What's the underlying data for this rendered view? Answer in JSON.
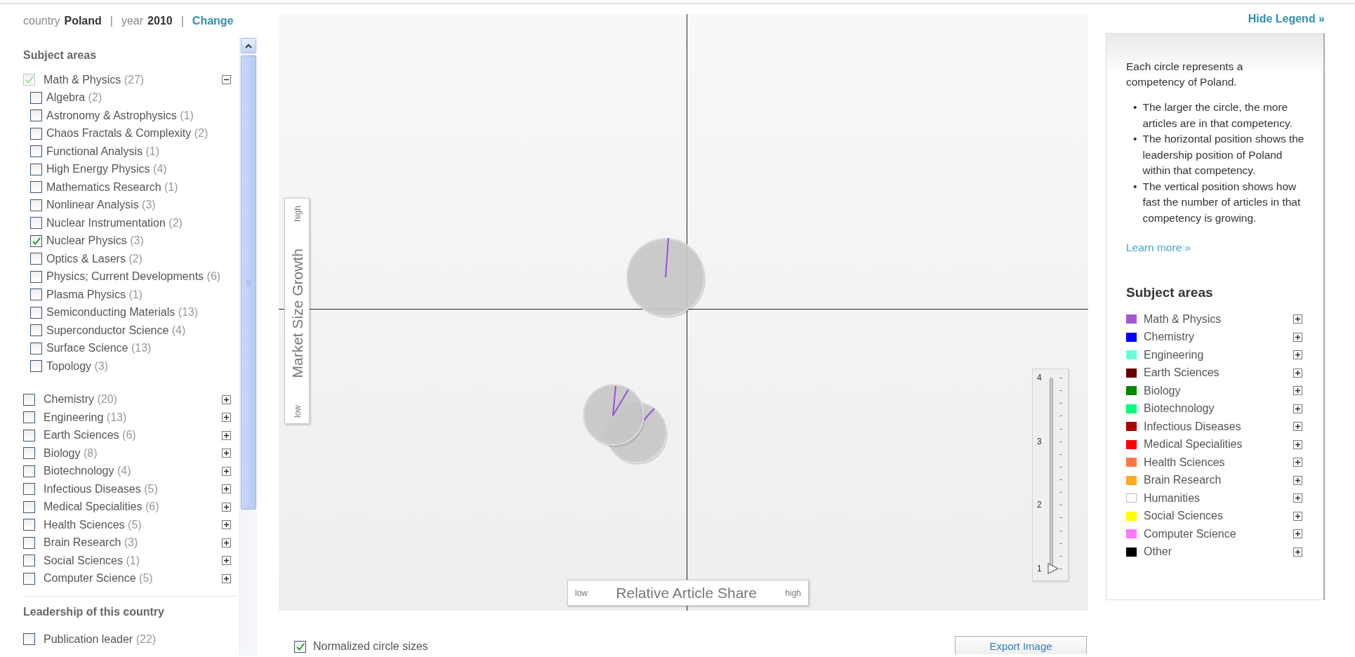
{
  "header": {
    "country_label": "country",
    "country": "Poland",
    "year_label": "year",
    "year": "2010",
    "separators": [
      "|",
      "|"
    ],
    "change_link": "Change"
  },
  "filters": {
    "title": "Subject areas",
    "groups": [
      {
        "label": "Math & Physics",
        "count": "(27)",
        "checked": true,
        "expanded": true,
        "children": [
          {
            "label": "Algebra",
            "count": "(2)",
            "checked": false
          },
          {
            "label": "Astronomy & Astrophysics",
            "count": "(1)",
            "checked": false
          },
          {
            "label": "Chaos Fractals & Complexity",
            "count": "(2)",
            "checked": false
          },
          {
            "label": "Functional Analysis",
            "count": "(1)",
            "checked": false
          },
          {
            "label": "High Energy Physics",
            "count": "(4)",
            "checked": false
          },
          {
            "label": "Mathematics Research",
            "count": "(1)",
            "checked": false
          },
          {
            "label": "Nonlinear Analysis",
            "count": "(3)",
            "checked": false
          },
          {
            "label": "Nuclear Instrumentation",
            "count": "(2)",
            "checked": false
          },
          {
            "label": "Nuclear Physics",
            "count": "(3)",
            "checked": true
          },
          {
            "label": "Optics & Lasers",
            "count": "(2)",
            "checked": false
          },
          {
            "label": "Physics; Current Developments",
            "count": "(6)",
            "checked": false
          },
          {
            "label": "Plasma Physics",
            "count": "(1)",
            "checked": false
          },
          {
            "label": "Semiconducting Materials",
            "count": "(13)",
            "checked": false
          },
          {
            "label": "Superconductor Science",
            "count": "(4)",
            "checked": false
          },
          {
            "label": "Surface Science",
            "count": "(13)",
            "checked": false
          },
          {
            "label": "Topology",
            "count": "(3)",
            "checked": false
          }
        ]
      },
      {
        "label": "Chemistry",
        "count": "(20)",
        "checked": false,
        "expanded": false
      },
      {
        "label": "Engineering",
        "count": "(13)",
        "checked": false,
        "expanded": false
      },
      {
        "label": "Earth Sciences",
        "count": "(6)",
        "checked": false,
        "expanded": false
      },
      {
        "label": "Biology",
        "count": "(8)",
        "checked": false,
        "expanded": false
      },
      {
        "label": "Biotechnology",
        "count": "(4)",
        "checked": false,
        "expanded": false
      },
      {
        "label": "Infectious Diseases",
        "count": "(5)",
        "checked": false,
        "expanded": false
      },
      {
        "label": "Medical Specialities",
        "count": "(6)",
        "checked": false,
        "expanded": false
      },
      {
        "label": "Health Sciences",
        "count": "(5)",
        "checked": false,
        "expanded": false
      },
      {
        "label": "Brain Research",
        "count": "(3)",
        "checked": false,
        "expanded": false
      },
      {
        "label": "Social Sciences",
        "count": "(1)",
        "checked": false,
        "expanded": false
      },
      {
        "label": "Computer Science",
        "count": "(5)",
        "checked": false,
        "expanded": false
      }
    ]
  },
  "leadership": {
    "title": "Leadership of this country",
    "items": [
      {
        "label": "Publication leader",
        "count": "(22)",
        "checked": false
      }
    ]
  },
  "chart": {
    "y_axis": {
      "title": "Market Size Growth",
      "low": "low",
      "high": "high"
    },
    "x_axis": {
      "title": "Relative Article Share",
      "low": "low",
      "high": "high"
    },
    "zoom_slider": {
      "ticks": [
        "4",
        "3",
        "2",
        "1"
      ],
      "level": 0
    }
  },
  "normalized_sizes": {
    "label": "Normalized circle sizes",
    "checked": true
  },
  "export_button": "Export Image",
  "legend": {
    "hide_link": "Hide Legend »",
    "intro": "Each circle represents a competency of Poland.",
    "bullets": [
      {
        "marker": "•",
        "text": "The larger the circle, the more articles are in that competency."
      },
      {
        "marker": "•",
        "text": "The horizontal position shows the leadership position of Poland within that competency."
      },
      {
        "marker": "•",
        "text": "The vertical position shows how fast the number of articles in that competency is growing."
      }
    ],
    "learn_more": "Learn more »",
    "title": "Subject areas",
    "items": [
      {
        "label": "Math & Physics",
        "color": "#a259d0",
        "expanded": false
      },
      {
        "label": "Chemistry",
        "color": "#0000ff",
        "expanded": false
      },
      {
        "label": "Engineering",
        "color": "#66ffdd",
        "expanded": false
      },
      {
        "label": "Earth Sciences",
        "color": "#660000",
        "expanded": false
      },
      {
        "label": "Biology",
        "color": "#008800",
        "expanded": false
      },
      {
        "label": "Biotechnology",
        "color": "#00ff77",
        "expanded": false
      },
      {
        "label": "Infectious Diseases",
        "color": "#aa0000",
        "expanded": false
      },
      {
        "label": "Medical Specialities",
        "color": "#ff0000",
        "expanded": false
      },
      {
        "label": "Health Sciences",
        "color": "#ff7744",
        "expanded": false
      },
      {
        "label": "Brain Research",
        "color": "#ffaa22",
        "expanded": false
      },
      {
        "label": "Humanities",
        "color": "#ffffff",
        "expanded": false
      },
      {
        "label": "Social Sciences",
        "color": "#ffff00",
        "expanded": false
      },
      {
        "label": "Computer Science",
        "color": "#ff77ff",
        "expanded": false
      },
      {
        "label": "Other",
        "color": "#000000",
        "expanded": false
      }
    ]
  }
}
